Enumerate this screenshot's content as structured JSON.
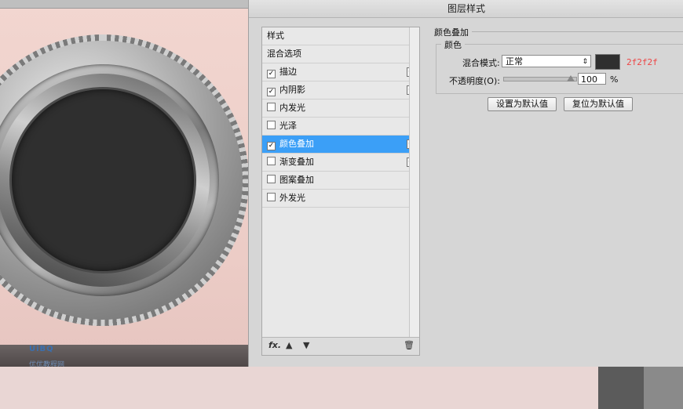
{
  "dialog": {
    "title": "图层样式",
    "styles_list": [
      {
        "label": "样式",
        "checkbox": false,
        "checked": false,
        "plus": false,
        "selected": false
      },
      {
        "label": "混合选项",
        "checkbox": false,
        "checked": false,
        "plus": false,
        "selected": false
      },
      {
        "label": "描边",
        "checkbox": true,
        "checked": true,
        "plus": true,
        "selected": false
      },
      {
        "label": "内阴影",
        "checkbox": true,
        "checked": true,
        "plus": true,
        "selected": false
      },
      {
        "label": "内发光",
        "checkbox": true,
        "checked": false,
        "plus": false,
        "selected": false
      },
      {
        "label": "光泽",
        "checkbox": true,
        "checked": false,
        "plus": false,
        "selected": false
      },
      {
        "label": "颜色叠加",
        "checkbox": true,
        "checked": true,
        "plus": true,
        "selected": true
      },
      {
        "label": "渐变叠加",
        "checkbox": true,
        "checked": false,
        "plus": true,
        "selected": false
      },
      {
        "label": "图案叠加",
        "checkbox": true,
        "checked": false,
        "plus": false,
        "selected": false
      },
      {
        "label": "外发光",
        "checkbox": true,
        "checked": false,
        "plus": false,
        "selected": false
      }
    ],
    "footer": {
      "fx": "fx."
    },
    "panel": {
      "section_title": "颜色叠加",
      "group_title": "颜色",
      "blend_label": "混合模式:",
      "blend_value": "正常",
      "swatch_color": "#2f2f2f",
      "hex_note": "2f2f2f",
      "opacity_label": "不透明度(O):",
      "opacity_value": "100",
      "opacity_unit": "%",
      "btn_default": "设置为默认值",
      "btn_reset": "复位为默认值"
    }
  },
  "watermark": {
    "text": "UiBQ",
    "sub": "优优教程网"
  }
}
